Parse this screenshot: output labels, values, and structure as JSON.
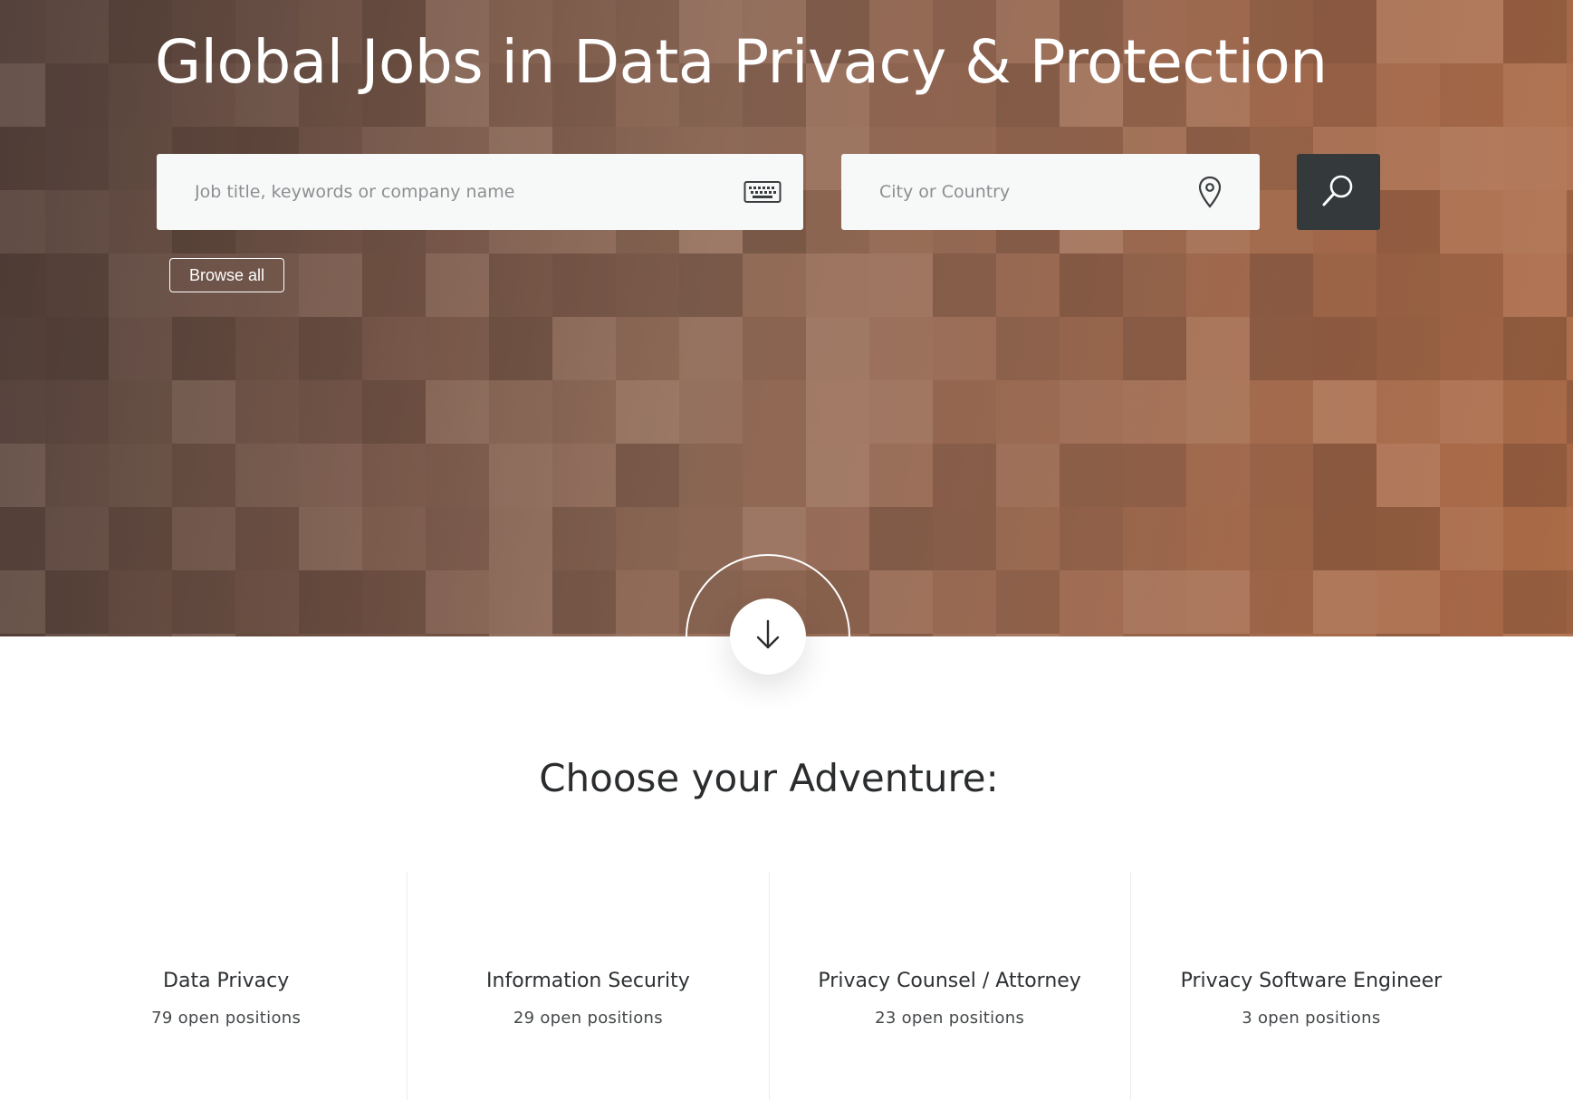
{
  "hero": {
    "title": "Global Jobs in Data Privacy & Protection",
    "background_color": "#9a6a52"
  },
  "search": {
    "keywords_placeholder": "Job title, keywords or company name",
    "location_placeholder": "City or Country",
    "keywords_icon": "keyboard-icon",
    "location_icon": "map-pin-icon",
    "submit_icon": "search-icon",
    "submit_color": "#343a3c"
  },
  "browse": {
    "label": "Browse all"
  },
  "scroll": {
    "icon": "arrow-down-icon"
  },
  "section": {
    "title": "Choose your Adventure:"
  },
  "categories": [
    {
      "name": "Data Privacy",
      "count": "79 open positions"
    },
    {
      "name": "Information Security",
      "count": "29 open positions"
    },
    {
      "name": "Privacy Counsel / Attorney",
      "count": "23 open positions"
    },
    {
      "name": "Privacy Software Engineer",
      "count": "3 open positions"
    }
  ]
}
